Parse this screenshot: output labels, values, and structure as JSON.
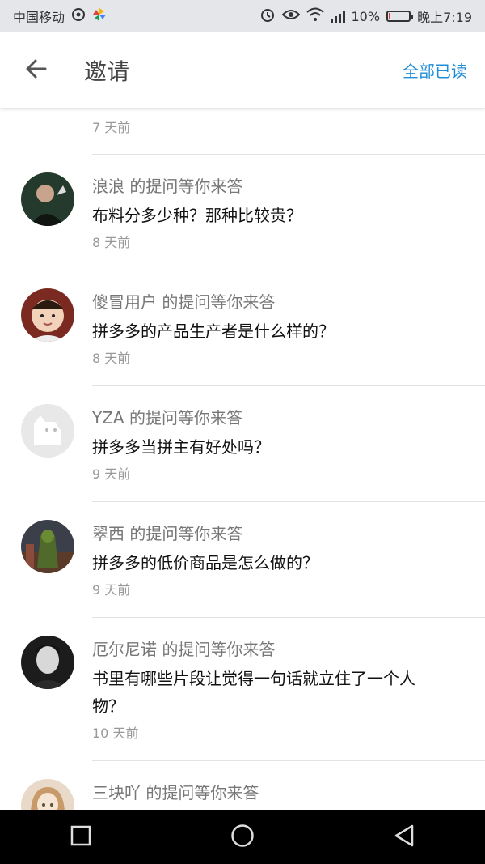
{
  "status_bar": {
    "carrier": "中国移动",
    "battery": "10%",
    "battery_level": 0.1,
    "time": "晚上7:19"
  },
  "header": {
    "back_icon": "arrow-left-icon",
    "title": "邀请",
    "mark_all_read": "全部已读"
  },
  "colors": {
    "accent": "#1f8ed8"
  },
  "items": [
    {
      "time": "7 天前"
    },
    {
      "inviter": "浪浪 的提问等你来答",
      "question": "布料分多少种？那种比较贵？",
      "time": "8 天前"
    },
    {
      "inviter": "傻冒用户 的提问等你来答",
      "question": "拼多多的产品生产者是什么样的？",
      "time": "8 天前"
    },
    {
      "inviter": "YZA 的提问等你来答",
      "question": "拼多多当拼主有好处吗？",
      "time": "9 天前"
    },
    {
      "inviter": "翠西 的提问等你来答",
      "question": "拼多多的低价商品是怎么做的？",
      "time": "9 天前"
    },
    {
      "inviter": "厄尔尼诺 的提问等你来答",
      "question": "书里有哪些片段让觉得一句话就立住了一个人物？",
      "time": "10 天前"
    },
    {
      "inviter": "三块吖 的提问等你来答",
      "question": "",
      "time": ""
    }
  ],
  "nav_bar": {
    "icons": [
      "square-icon",
      "circle-icon",
      "triangle-back-icon"
    ]
  }
}
